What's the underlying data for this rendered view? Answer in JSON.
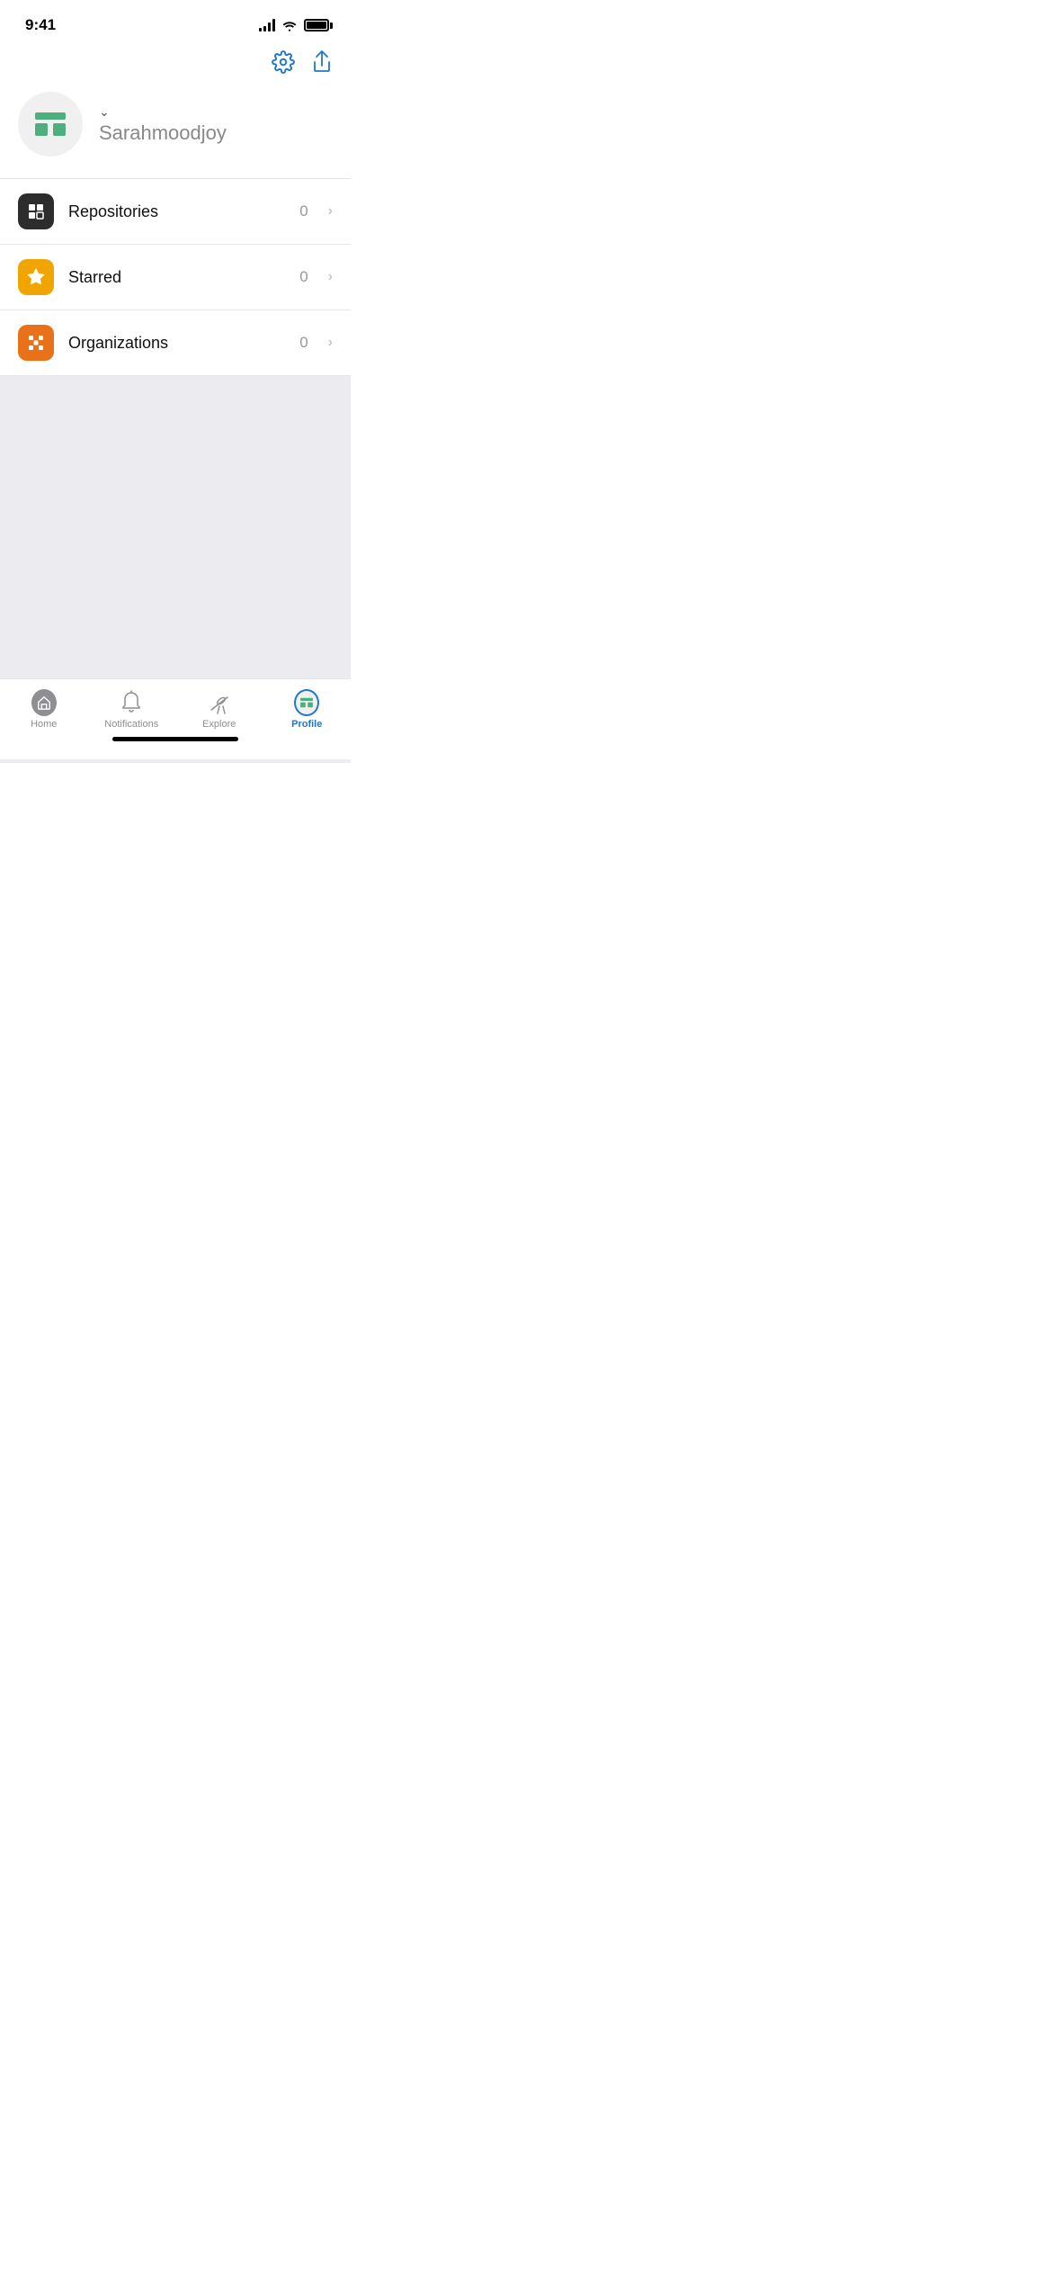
{
  "statusBar": {
    "time": "9:41"
  },
  "header": {
    "settingsLabel": "Settings",
    "shareLabel": "Share"
  },
  "profile": {
    "username": "Sarahmoodjoy",
    "dropdownAriaLabel": "Switch account"
  },
  "menuItems": [
    {
      "id": "repositories",
      "label": "Repositories",
      "count": "0",
      "iconColor": "dark"
    },
    {
      "id": "starred",
      "label": "Starred",
      "count": "0",
      "iconColor": "yellow"
    },
    {
      "id": "organizations",
      "label": "Organizations",
      "count": "0",
      "iconColor": "orange"
    }
  ],
  "bottomNav": [
    {
      "id": "home",
      "label": "Home",
      "active": false
    },
    {
      "id": "notifications",
      "label": "Notifications",
      "active": false
    },
    {
      "id": "explore",
      "label": "Explore",
      "active": false
    },
    {
      "id": "profile",
      "label": "Profile",
      "active": true
    }
  ]
}
